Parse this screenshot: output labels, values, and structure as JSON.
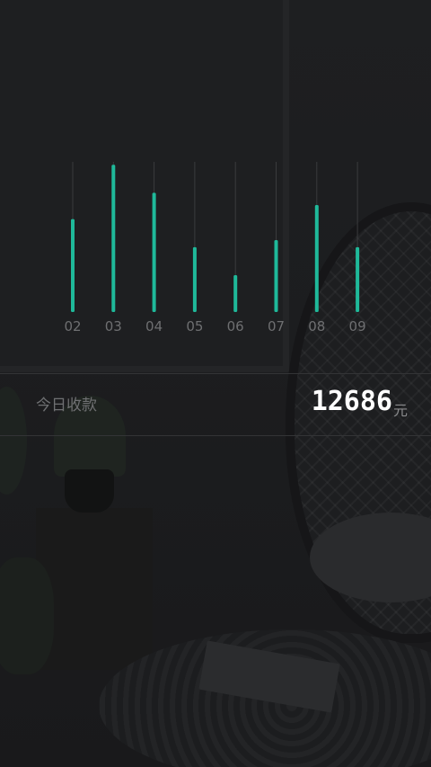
{
  "chart_data": {
    "type": "bar",
    "categories": [
      "02",
      "03",
      "04",
      "05",
      "06",
      "07",
      "08",
      "09"
    ],
    "values": [
      0.53,
      0.84,
      0.68,
      0.37,
      0.21,
      0.41,
      0.61,
      0.37
    ],
    "ylim": [
      0,
      1
    ],
    "bar_color": "#1fb99a",
    "track_color": "#3a3b3d",
    "grid": false
  },
  "income": {
    "label": "今日收款",
    "amount": "12686",
    "unit": "元"
  },
  "colors": {
    "accent": "#1fb99a",
    "background": "#1c1d1f",
    "amount_text": "#ffffff"
  }
}
